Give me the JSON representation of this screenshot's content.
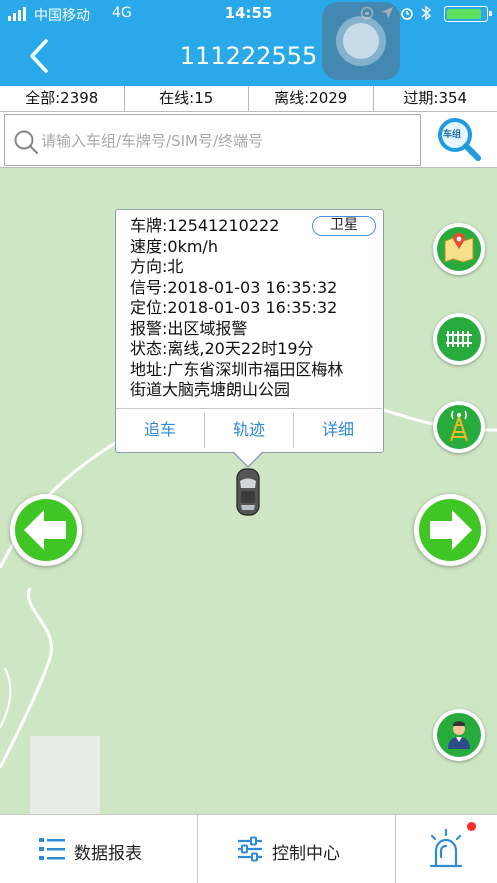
{
  "status_bar": {
    "carrier": "中国移动",
    "network": "4G",
    "time": "14:55"
  },
  "header": {
    "title": "111222555"
  },
  "stats": [
    {
      "label": "全部:2398"
    },
    {
      "label": "在线:15"
    },
    {
      "label": "离线:2029"
    },
    {
      "label": "过期:354"
    }
  ],
  "search": {
    "placeholder": "请输入车组/车牌号/SIM号/终端号",
    "group_button_label": "车组"
  },
  "vehicle_popup": {
    "plate": "车牌:12541210222",
    "locate_mode": "卫星",
    "speed": "速度:0km/h",
    "direction": "方向:北",
    "signal_time": "信号:2018-01-03 16:35:32",
    "position_time": "定位:2018-01-03 16:35:32",
    "alarm": "报警:出区域报警",
    "state": "状态:离线,20天22时19分",
    "address_line1": "地址:广东省深圳市福田区梅林",
    "address_line2": "街道大脑壳塘朗山公园",
    "actions": {
      "chase": "追车",
      "track": "轨迹",
      "detail": "详细"
    }
  },
  "bottom_tabs": {
    "report": "数据报表",
    "control": "控制中心"
  },
  "colors": {
    "header": "#29a9ea",
    "accent_green": "#3fc625",
    "link_blue": "#2f8ad8",
    "alarm_dot": "#ff2a2a"
  },
  "icons": {
    "back": "chevron-left-icon",
    "map_layers": "map-icon",
    "railway": "railway-icon",
    "tower": "signal-tower-icon",
    "prev": "arrow-left-icon",
    "next": "arrow-right-icon",
    "person": "user-icon",
    "report": "list-icon",
    "control": "sliders-icon",
    "alarm": "alarm-light-icon"
  }
}
